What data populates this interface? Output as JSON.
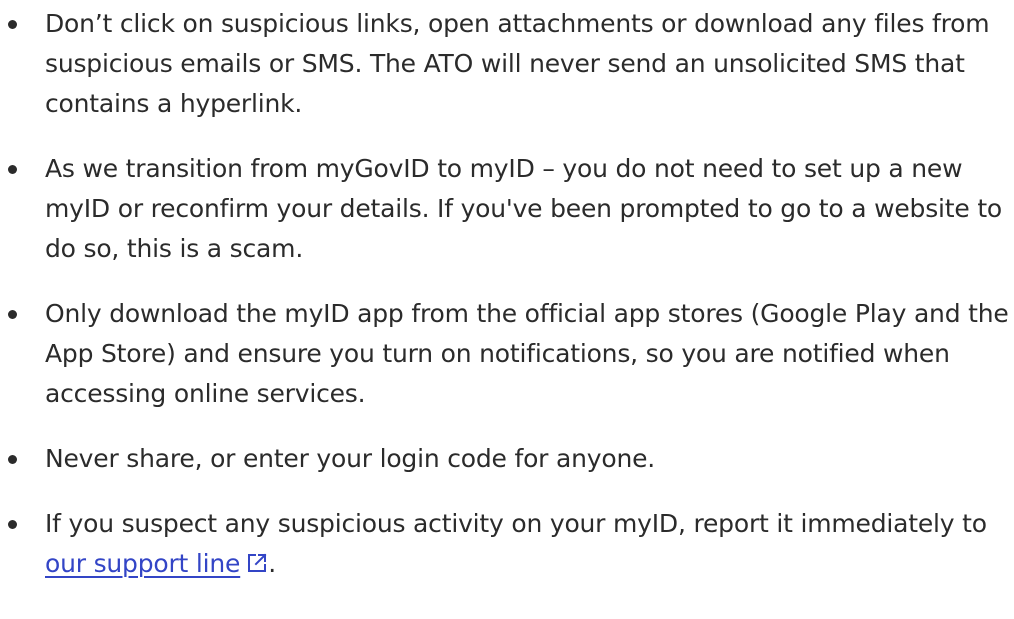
{
  "tips": [
    {
      "text": "Don’t click on suspicious links, open attachments or download any files from suspicious emails or SMS. The ATO will never send an unsolicited SMS that contains a hyperlink."
    },
    {
      "text": "As we transition from myGovID to myID – you do not need to set up a new myID or reconfirm your details. If you've been prompted to go to a website to do so, this is a scam."
    },
    {
      "text": "Only download the myID app from the official app stores (Google Play and the App Store) and ensure you turn on notifications, so you are notified when accessing online services."
    },
    {
      "text": "Never share, or enter your login code for anyone."
    },
    {
      "text_before": "If you suspect any suspicious activity on your myID, report it immediately to ",
      "link_label": "our support line",
      "link_icon": "external-link-icon",
      "text_after": "."
    }
  ],
  "colors": {
    "text": "#2b2b2b",
    "link": "#3345c6"
  }
}
